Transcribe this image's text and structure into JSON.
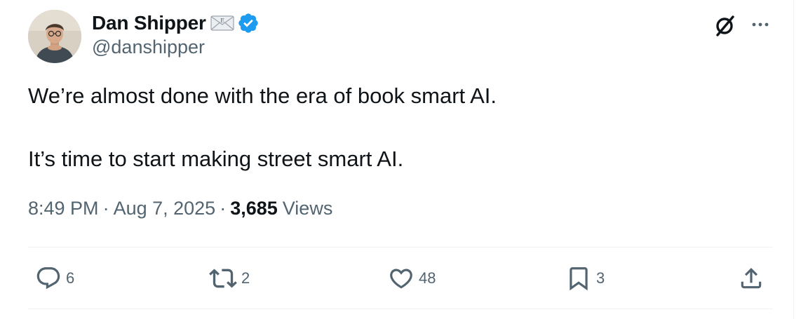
{
  "author": {
    "name": "Dan Shipper",
    "handle": "@danshipper"
  },
  "tweet": {
    "line1": "We’re almost done with the era of book smart AI.",
    "line2": "It’s time to start making street smart AI."
  },
  "meta": {
    "time": "8:49 PM",
    "separator": "·",
    "date": "Aug 7, 2025",
    "views_count": "3,685",
    "views_label": "Views"
  },
  "actions": {
    "replies": "6",
    "reposts": "2",
    "likes": "48",
    "bookmarks": "3"
  },
  "icons": {
    "mail_badge": "envelope-emoji-icon",
    "mail_badge_letter": "E",
    "verified": "verified-badge-icon",
    "grok": "grok-icon",
    "more": "more-dots-icon",
    "reply": "reply-icon",
    "repost": "repost-icon",
    "like": "heart-icon",
    "bookmark": "bookmark-icon",
    "share": "share-icon"
  },
  "colors": {
    "text": "#0f1419",
    "secondary": "#536471",
    "verified_blue": "#1d9bf0",
    "divider": "#eff3f4"
  }
}
